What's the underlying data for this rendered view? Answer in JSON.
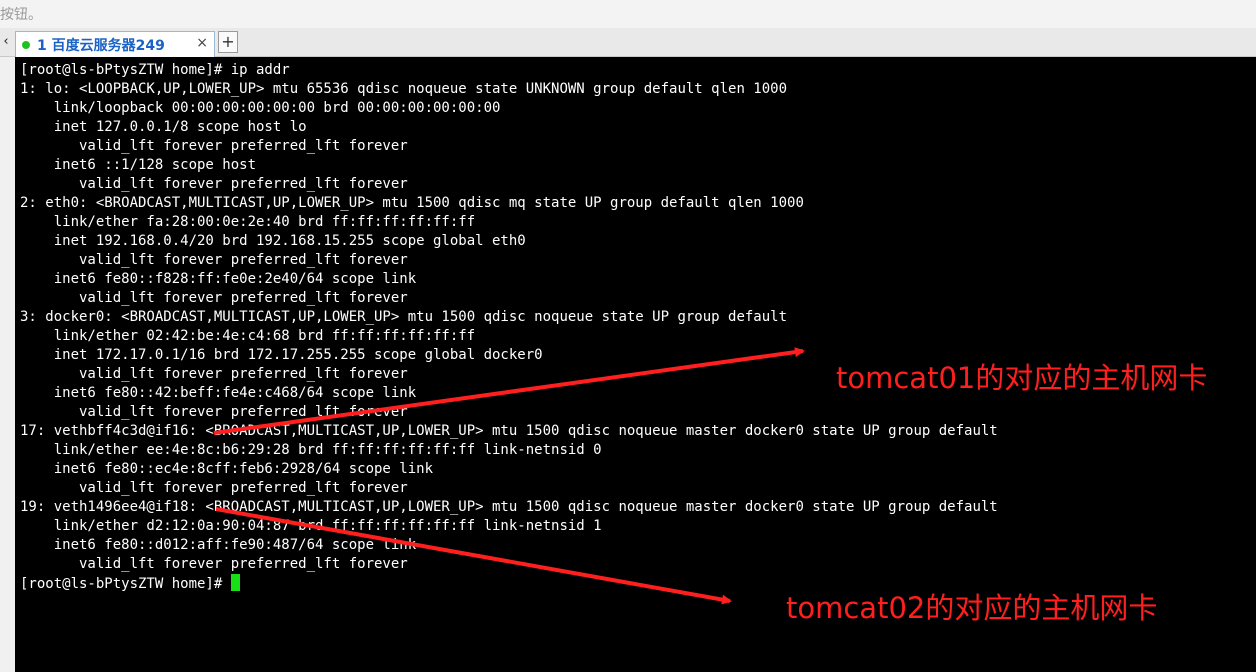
{
  "top_hint": "按钮。",
  "tab": {
    "title": "1 百度云服务器249",
    "close": "×"
  },
  "newtab": "+",
  "tab_scroll_icon": "arrow-left-icon",
  "terminal": {
    "lines": [
      "[root@ls-bPtysZTW home]# ip addr",
      "1: lo: <LOOPBACK,UP,LOWER_UP> mtu 65536 qdisc noqueue state UNKNOWN group default qlen 1000",
      "    link/loopback 00:00:00:00:00:00 brd 00:00:00:00:00:00",
      "    inet 127.0.0.1/8 scope host lo",
      "       valid_lft forever preferred_lft forever",
      "    inet6 ::1/128 scope host",
      "       valid_lft forever preferred_lft forever",
      "2: eth0: <BROADCAST,MULTICAST,UP,LOWER_UP> mtu 1500 qdisc mq state UP group default qlen 1000",
      "    link/ether fa:28:00:0e:2e:40 brd ff:ff:ff:ff:ff:ff",
      "    inet 192.168.0.4/20 brd 192.168.15.255 scope global eth0",
      "       valid_lft forever preferred_lft forever",
      "    inet6 fe80::f828:ff:fe0e:2e40/64 scope link",
      "       valid_lft forever preferred_lft forever",
      "3: docker0: <BROADCAST,MULTICAST,UP,LOWER_UP> mtu 1500 qdisc noqueue state UP group default",
      "    link/ether 02:42:be:4e:c4:68 brd ff:ff:ff:ff:ff:ff",
      "    inet 172.17.0.1/16 brd 172.17.255.255 scope global docker0",
      "       valid_lft forever preferred_lft forever",
      "    inet6 fe80::42:beff:fe4e:c468/64 scope link",
      "       valid_lft forever preferred_lft forever",
      "17: vethbff4c3d@if16: <BROADCAST,MULTICAST,UP,LOWER_UP> mtu 1500 qdisc noqueue master docker0 state UP group default",
      "    link/ether ee:4e:8c:b6:29:28 brd ff:ff:ff:ff:ff:ff link-netnsid 0",
      "    inet6 fe80::ec4e:8cff:feb6:2928/64 scope link",
      "       valid_lft forever preferred_lft forever",
      "19: veth1496ee4@if18: <BROADCAST,MULTICAST,UP,LOWER_UP> mtu 1500 qdisc noqueue master docker0 state UP group default",
      "    link/ether d2:12:0a:90:04:87 brd ff:ff:ff:ff:ff:ff link-netnsid 1",
      "    inet6 fe80::d012:aff:fe90:487/64 scope link",
      "       valid_lft forever preferred_lft forever"
    ],
    "prompt": "[root@ls-bPtysZTW home]# "
  },
  "annotations": {
    "tomcat01": "tomcat01的对应的主机网卡",
    "tomcat02": "tomcat02的对应的主机网卡"
  },
  "colors": {
    "terminal_bg": "#000000",
    "terminal_fg": "#ffffff",
    "cursor": "#17e017",
    "annotation": "#ff1f1f",
    "tab_title": "#1a62c6"
  }
}
